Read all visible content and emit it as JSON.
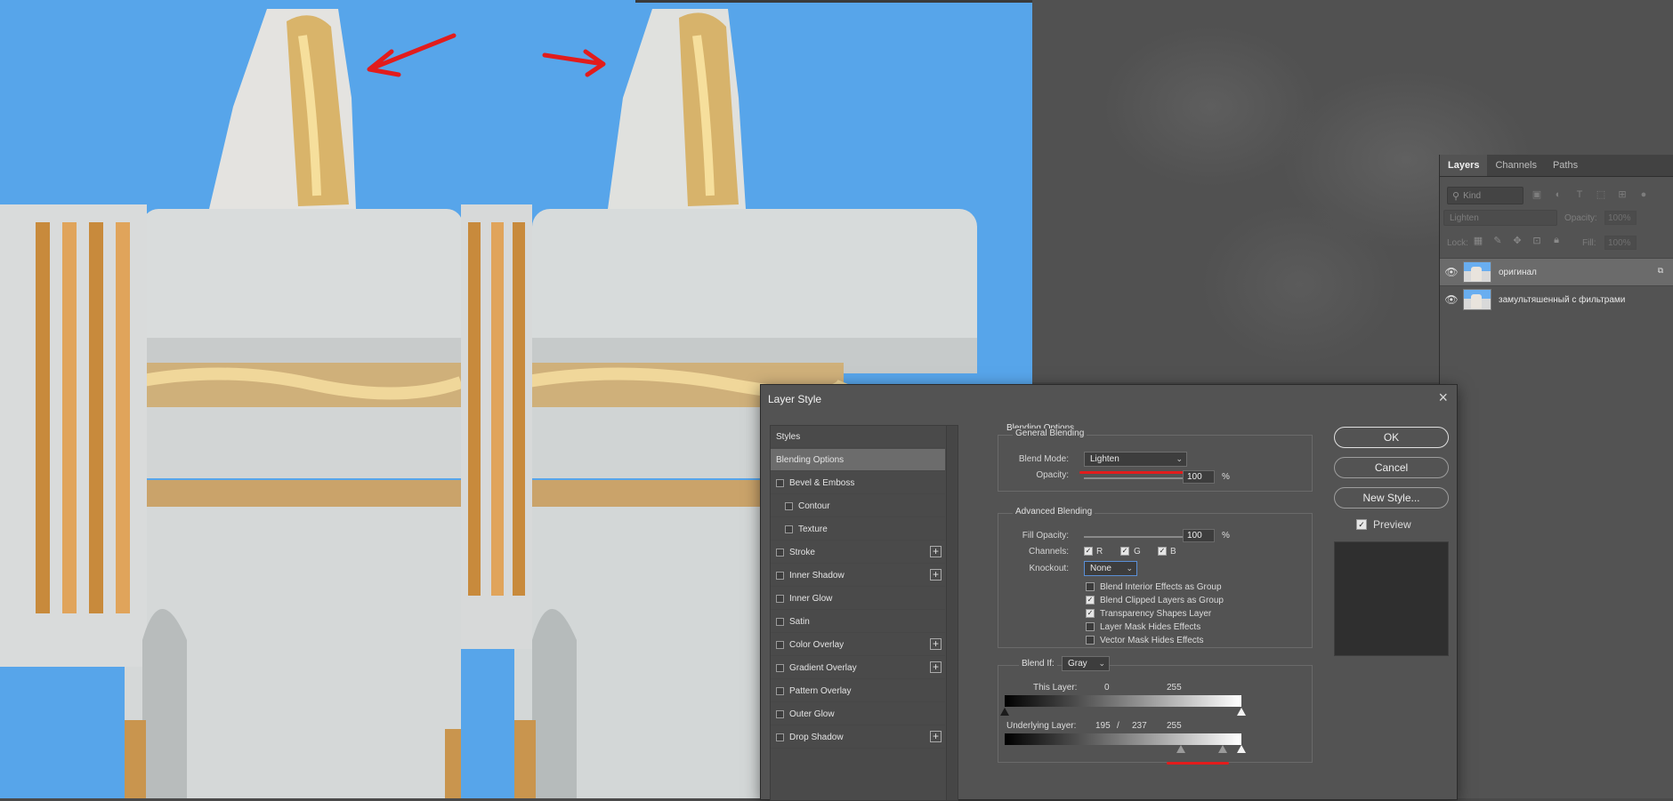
{
  "colors": {
    "sky": "#57a5ea",
    "panel_bg": "#535353",
    "annotation_red": "#e21c1c"
  },
  "layers_panel": {
    "tabs": [
      "Layers",
      "Channels",
      "Paths"
    ],
    "kind_filter": "Kind",
    "blend_mode": "Lighten",
    "opacity_label": "Opacity:",
    "opacity_value": "100%",
    "lock_label": "Lock:",
    "fill_label": "Fill:",
    "fill_value": "100%",
    "layers": [
      {
        "name": "оригинал",
        "visible": true,
        "selected": true,
        "smart_object": true
      },
      {
        "name": "замультяшенный с фильтрами",
        "visible": true,
        "selected": false,
        "smart_object": false
      }
    ]
  },
  "dialog": {
    "title": "Layer Style",
    "styles_header": "Styles",
    "style_items": [
      {
        "label": "Blending Options",
        "checkbox": false,
        "selected": true,
        "plus": false,
        "indent": false
      },
      {
        "label": "Bevel & Emboss",
        "checkbox": true,
        "selected": false,
        "plus": false,
        "indent": false
      },
      {
        "label": "Contour",
        "checkbox": true,
        "selected": false,
        "plus": false,
        "indent": true
      },
      {
        "label": "Texture",
        "checkbox": true,
        "selected": false,
        "plus": false,
        "indent": true
      },
      {
        "label": "Stroke",
        "checkbox": true,
        "selected": false,
        "plus": true,
        "indent": false
      },
      {
        "label": "Inner Shadow",
        "checkbox": true,
        "selected": false,
        "plus": true,
        "indent": false
      },
      {
        "label": "Inner Glow",
        "checkbox": true,
        "selected": false,
        "plus": false,
        "indent": false
      },
      {
        "label": "Satin",
        "checkbox": true,
        "selected": false,
        "plus": false,
        "indent": false
      },
      {
        "label": "Color Overlay",
        "checkbox": true,
        "selected": false,
        "plus": true,
        "indent": false
      },
      {
        "label": "Gradient Overlay",
        "checkbox": true,
        "selected": false,
        "plus": true,
        "indent": false
      },
      {
        "label": "Pattern Overlay",
        "checkbox": true,
        "selected": false,
        "plus": false,
        "indent": false
      },
      {
        "label": "Outer Glow",
        "checkbox": true,
        "selected": false,
        "plus": false,
        "indent": false
      },
      {
        "label": "Drop Shadow",
        "checkbox": true,
        "selected": false,
        "plus": true,
        "indent": false
      }
    ],
    "blending_options_title": "Blending Options",
    "general_blending": {
      "label": "General Blending",
      "blend_mode_label": "Blend Mode:",
      "blend_mode_value": "Lighten",
      "opacity_label": "Opacity:",
      "opacity_value": "100",
      "percent": "%"
    },
    "advanced_blending": {
      "label": "Advanced Blending",
      "fill_opacity_label": "Fill Opacity:",
      "fill_opacity_value": "100",
      "percent": "%",
      "channels_label": "Channels:",
      "channels": [
        {
          "label": "R",
          "checked": true
        },
        {
          "label": "G",
          "checked": true
        },
        {
          "label": "B",
          "checked": true
        }
      ],
      "knockout_label": "Knockout:",
      "knockout_value": "None",
      "options": [
        {
          "label": "Blend Interior Effects as Group",
          "checked": false
        },
        {
          "label": "Blend Clipped Layers as Group",
          "checked": true
        },
        {
          "label": "Transparency Shapes Layer",
          "checked": true
        },
        {
          "label": "Layer Mask Hides Effects",
          "checked": false
        },
        {
          "label": "Vector Mask Hides Effects",
          "checked": false
        }
      ]
    },
    "blend_if": {
      "label": "Blend If:",
      "channel": "Gray",
      "this_layer_label": "This Layer:",
      "this_layer_low": "0",
      "this_layer_high": "255",
      "underlying_label": "Underlying Layer:",
      "underlying_low": "195",
      "underlying_sep": "/",
      "underlying_mid": "237",
      "underlying_high": "255"
    },
    "buttons": {
      "ok": "OK",
      "cancel": "Cancel",
      "new_style": "New Style..."
    },
    "preview_label": "Preview",
    "preview_checked": true
  }
}
